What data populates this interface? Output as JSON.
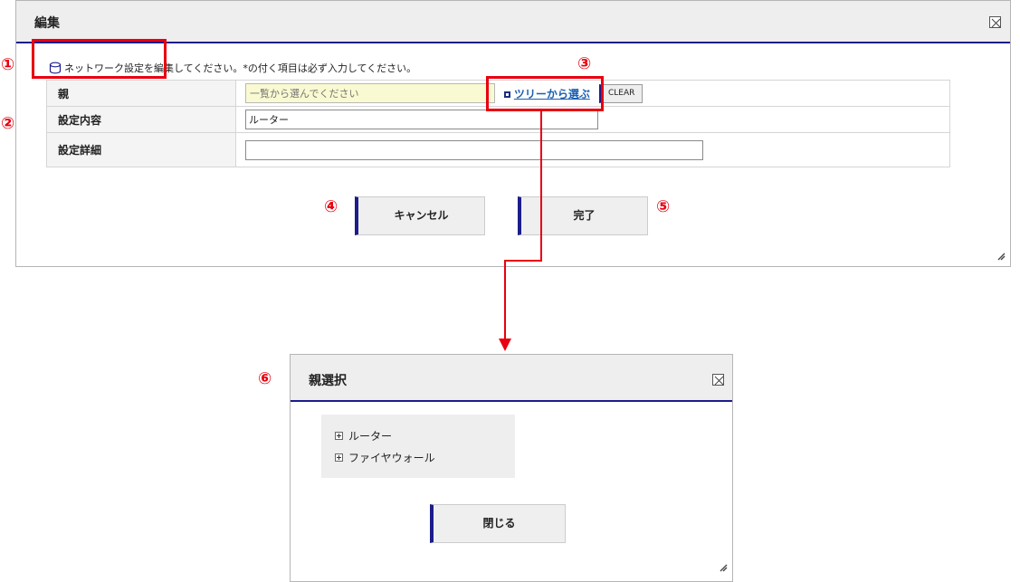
{
  "edit_dialog": {
    "title": "編集",
    "info_text": "ネットワーク設定を編集してください。*の付く項目は必ず入力してください。",
    "form": {
      "parent_label": "親",
      "parent_placeholder": "一覧から選んでください",
      "tree_link_label": "ツリーから選ぶ",
      "clear_label": "CLEAR",
      "setting_label": "設定内容",
      "setting_value": "ルーター",
      "detail_label": "設定詳細",
      "detail_value": ""
    },
    "cancel_label": "キャンセル",
    "done_label": "完了"
  },
  "select_dialog": {
    "title": "親選択",
    "tree_items": [
      "ルーター",
      "ファイヤウォール"
    ],
    "close_label": "閉じる"
  },
  "annotations": {
    "n1": "①",
    "n2": "②",
    "n3": "③",
    "n4": "④",
    "n5": "⑤",
    "n6": "⑥"
  },
  "colors": {
    "accent": "#1c1c8c",
    "annotation_red": "#e8000f",
    "link": "#1a5fb0",
    "input_highlight": "#fafad2"
  }
}
